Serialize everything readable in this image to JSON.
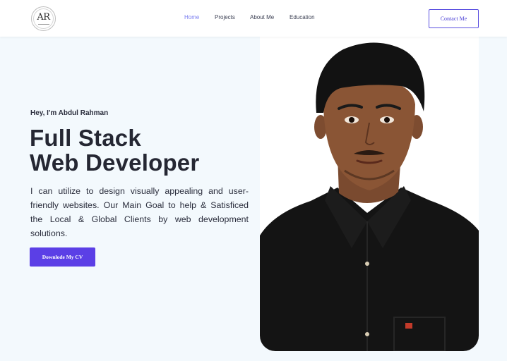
{
  "brand": {
    "logo_text": "AR"
  },
  "nav": {
    "items": [
      {
        "label": "Home",
        "active": true
      },
      {
        "label": "Projects",
        "active": false
      },
      {
        "label": "About Me",
        "active": false
      },
      {
        "label": "Education",
        "active": false
      }
    ],
    "contact_label": "Contact Me"
  },
  "hero": {
    "greeting": "Hey, I'm Abdul Rahman",
    "title_line1": "Full Stack",
    "title_line2": "Web Developer",
    "description": "I can utilize to design visually appealing and user-friendly websites. Our Main Goal to help & Satisficed the Local & Global Clients by web development solutions.",
    "cv_label": "Downlode My CV"
  },
  "colors": {
    "accent": "#5b3fe6",
    "nav_active": "#7b7ff0",
    "background": "#f3f9fd",
    "heading": "#252733"
  }
}
